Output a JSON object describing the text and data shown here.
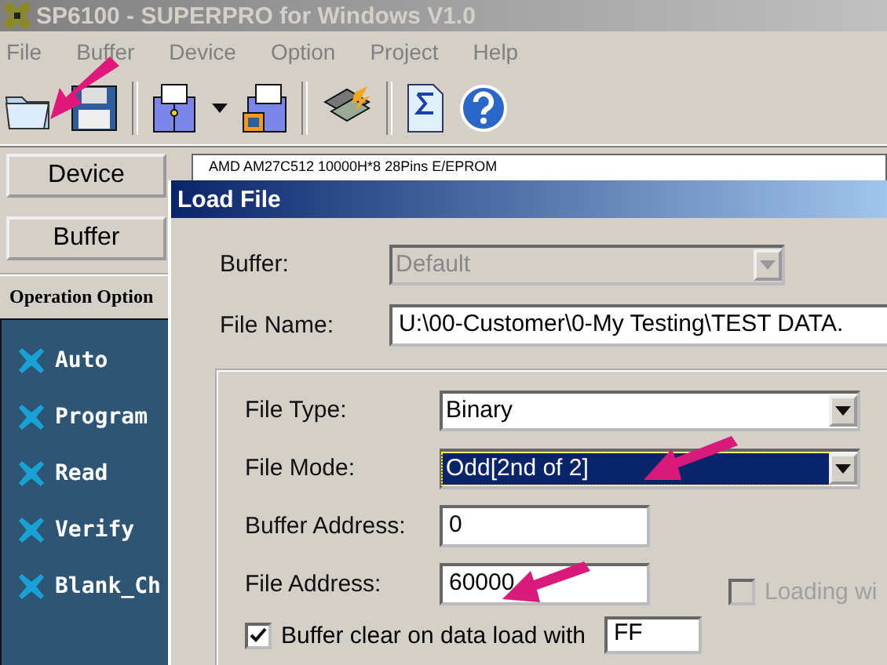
{
  "window": {
    "title": "SP6100 - SUPERPRO for Windows V1.0"
  },
  "menu": [
    {
      "label": "File"
    },
    {
      "label": "Buffer"
    },
    {
      "label": "Device"
    },
    {
      "label": "Option"
    },
    {
      "label": "Project"
    },
    {
      "label": "Help"
    }
  ],
  "sidebar": {
    "buttons": [
      "Device",
      "Buffer"
    ],
    "section_title": "Operation Option",
    "operations": [
      {
        "label": "Auto"
      },
      {
        "label": "Program"
      },
      {
        "label": "Read"
      },
      {
        "label": "Verify"
      },
      {
        "label": "Blank_Ch"
      }
    ]
  },
  "device_info": "AMD AM27C512 10000H*8 28Pins E/EPROM",
  "dialog": {
    "title": "Load File",
    "fields": [
      {
        "kind": "combo",
        "label": "Buffer:",
        "value": "Default",
        "disabled": true
      },
      {
        "kind": "text",
        "label": "File Name:",
        "value": "U:\\00-Customer\\0-My Testing\\TEST DATA."
      }
    ],
    "group_fields": [
      {
        "kind": "combo",
        "label": "File Type:",
        "value": "Binary",
        "selected": false
      },
      {
        "kind": "combo",
        "label": "File Mode:",
        "value": "Odd[2nd of 2]",
        "selected": true
      },
      {
        "kind": "text",
        "label": "Buffer Address:",
        "value": "0"
      },
      {
        "kind": "text",
        "label": "File Address:",
        "value": "60000"
      }
    ],
    "loading_option": {
      "label": "Loading wi",
      "checked": false,
      "disabled": true
    },
    "buffer_clear": {
      "label": "Buffer clear on data load with",
      "checked": true,
      "value": "FF"
    }
  }
}
